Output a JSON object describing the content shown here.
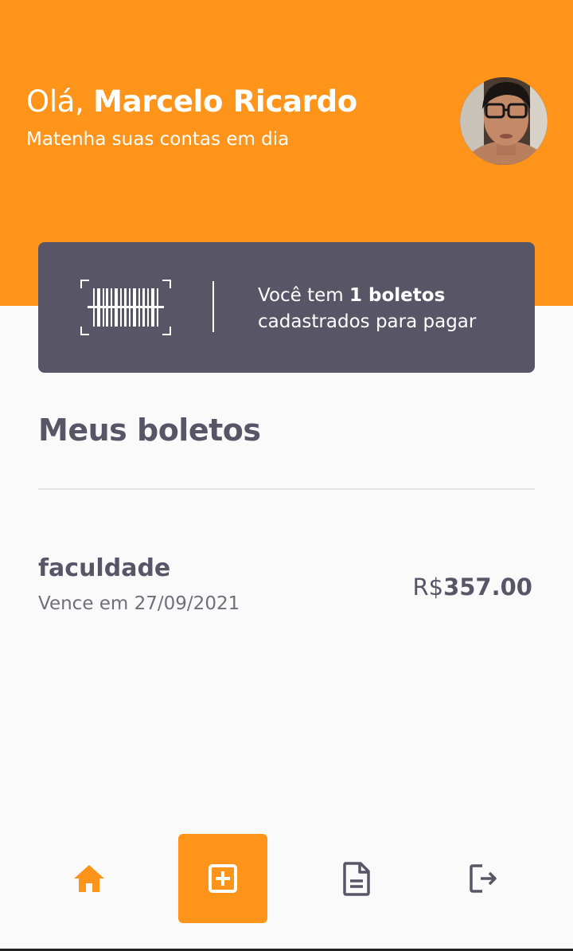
{
  "header": {
    "greeting_prefix": "Olá, ",
    "user_name": "Marcelo Ricardo",
    "subtitle": "Matenha suas contas em dia"
  },
  "summary_card": {
    "text_prefix": "Você tem ",
    "count_label": "1 boletos",
    "text_suffix": "cadastrados para pagar"
  },
  "section": {
    "title": "Meus boletos"
  },
  "bills": [
    {
      "name": "faculdade",
      "due": "Vence em 27/09/2021",
      "currency": "R$",
      "amount": "357.00"
    }
  ],
  "nav": {
    "items": [
      {
        "icon": "home-icon",
        "active": true
      },
      {
        "icon": "add-box-icon",
        "active": false
      },
      {
        "icon": "document-icon",
        "active": false
      },
      {
        "icon": "logout-icon",
        "active": false
      }
    ]
  },
  "colors": {
    "primary": "#FF941A",
    "secondary": "#585666",
    "background": "#FAFAFA"
  }
}
